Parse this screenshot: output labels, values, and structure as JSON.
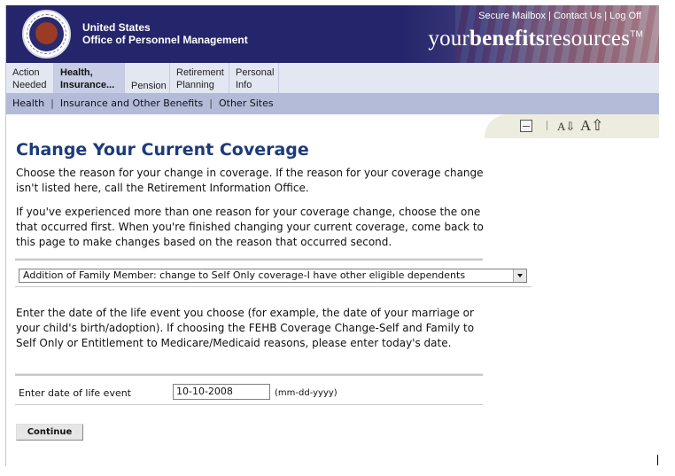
{
  "header": {
    "org_line1": "United States",
    "org_line2": "Office of Personnel Management",
    "links": [
      "Secure Mailbox",
      "Contact Us",
      "Log Off"
    ],
    "brand_light1": "your",
    "brand_bold": "benefits",
    "brand_light2": "resources",
    "brand_tm": "TM"
  },
  "tabs": [
    {
      "line1": "Action",
      "line2": "Needed"
    },
    {
      "line1": "Health,",
      "line2": "Insurance..."
    },
    {
      "line1": "",
      "line2": "Pension"
    },
    {
      "line1": "Retirement",
      "line2": "Planning"
    },
    {
      "line1": "Personal",
      "line2": "Info"
    }
  ],
  "subnav": [
    "Health",
    "Insurance and Other Benefits",
    "Other Sites"
  ],
  "tools": {
    "print_icon": "printer-icon",
    "font_down": "A⇩",
    "font_up": "A⇧"
  },
  "content": {
    "title": "Change Your Current Coverage",
    "para1": "Choose the reason for your change in coverage. If the reason for your coverage change isn't listed here, call the Retirement Information Office.",
    "para2": "If you've experienced more than one reason for your coverage change, choose the one that occurred first. When you're finished changing your current coverage, come back to this page to make changes based on the reason that occurred second.",
    "reason_selected": "Addition of Family Member: change to Self Only coverage-I have other eligible dependents",
    "para3": "Enter the date of the life event you choose (for example, the date of your marriage or your child's birth/adoption). If choosing the FEHB Coverage Change-Self and Family to Self Only or Entitlement to Medicare/Medicaid reasons, please enter today's date.",
    "date_label": "Enter date of life event",
    "date_value": "10-10-2008",
    "date_hint": "(mm-dd-yyyy)",
    "continue_label": "Continue"
  }
}
